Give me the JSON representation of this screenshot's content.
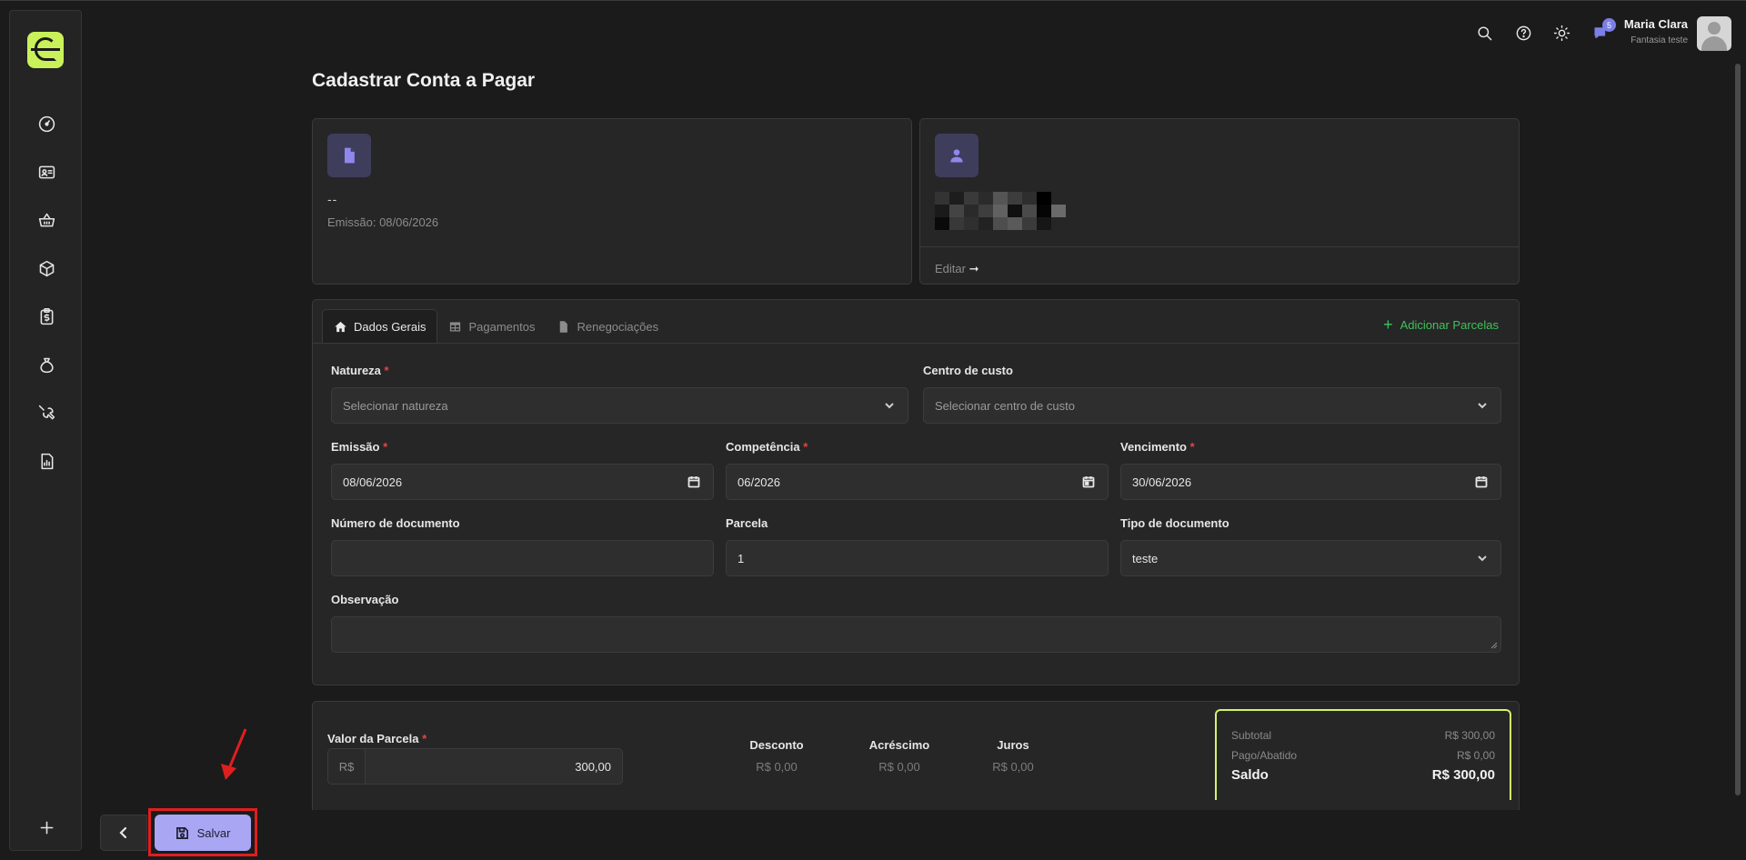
{
  "page": {
    "title": "Cadastrar Conta a Pagar"
  },
  "user": {
    "name": "Maria Clara",
    "company": "Fantasia teste",
    "notifications": "5"
  },
  "document_card": {
    "number": "--",
    "emission": "Emissão: 08/06/2026"
  },
  "supplier_card": {
    "edit_label": "Editar",
    "edit_arrow": "➞"
  },
  "tabs": [
    {
      "label": "Dados Gerais",
      "active": true
    },
    {
      "label": "Pagamentos",
      "active": false
    },
    {
      "label": "Renegociações",
      "active": false
    }
  ],
  "add_parcelas": {
    "label": "Adicionar Parcelas",
    "icon": "+"
  },
  "required_mark": "*",
  "form": {
    "natureza": {
      "label": "Natureza",
      "placeholder": "Selecionar natureza"
    },
    "centro_custo": {
      "label": "Centro de custo",
      "placeholder": "Selecionar centro de custo"
    },
    "emissao": {
      "label": "Emissão",
      "value": "08/06/2026"
    },
    "competencia": {
      "label": "Competência",
      "value": "06/2026"
    },
    "vencimento": {
      "label": "Vencimento",
      "value": "30/06/2026"
    },
    "numero_documento": {
      "label": "Número de documento",
      "value": ""
    },
    "parcela": {
      "label": "Parcela",
      "value": "1"
    },
    "tipo_documento": {
      "label": "Tipo de documento",
      "value": "teste"
    },
    "observacao": {
      "label": "Observação",
      "value": ""
    }
  },
  "valores": {
    "valor_parcela_label": "Valor da Parcela",
    "currency": "R$",
    "valor_parcela": "300,00",
    "desconto": {
      "label": "Desconto",
      "value": "R$ 0,00"
    },
    "acrescimo": {
      "label": "Acréscimo",
      "value": "R$ 0,00"
    },
    "juros": {
      "label": "Juros",
      "value": "R$ 0,00"
    }
  },
  "summary": {
    "subtotal": {
      "label": "Subtotal",
      "value": "R$ 300,00"
    },
    "pago": {
      "label": "Pago/Abatido",
      "value": "R$ 0,00"
    },
    "saldo": {
      "label": "Saldo",
      "value": "R$ 300,00"
    }
  },
  "actions": {
    "save_label": "Salvar"
  },
  "colors": {
    "accent": "#c9f15a",
    "primary_button": "#a9a7f4",
    "success": "#3fc25a",
    "highlight_outline": "#e01e1e"
  }
}
